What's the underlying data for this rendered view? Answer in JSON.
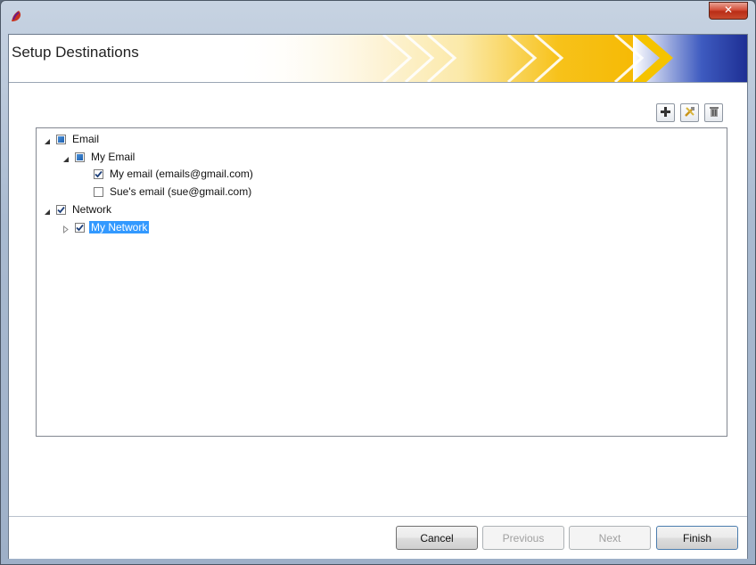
{
  "header": {
    "title": "Setup Destinations"
  },
  "toolbar": {
    "add_icon": "plus-icon",
    "edit_icon": "tools-icon",
    "delete_icon": "trash-icon"
  },
  "tree": {
    "email": {
      "label": "Email",
      "check": "partial",
      "expanded": true
    },
    "my_email_group": {
      "label": "My Email",
      "check": "partial",
      "expanded": true
    },
    "my_email": {
      "label": "My email (emails@gmail.com)",
      "check": "checked"
    },
    "sues_email": {
      "label": "Sue's email (sue@gmail.com)",
      "check": "unchecked"
    },
    "network": {
      "label": "Network",
      "check": "checked",
      "expanded": true
    },
    "my_network": {
      "label": "My Network",
      "check": "checked",
      "expanded": false,
      "selected": true
    }
  },
  "footer": {
    "cancel": "Cancel",
    "previous": "Previous",
    "next": "Next",
    "finish": "Finish"
  },
  "colors": {
    "selection": "#3399ff",
    "close_button": "#c84a2e",
    "banner_yellow": "#f7c21a",
    "banner_blue": "#23379a"
  }
}
